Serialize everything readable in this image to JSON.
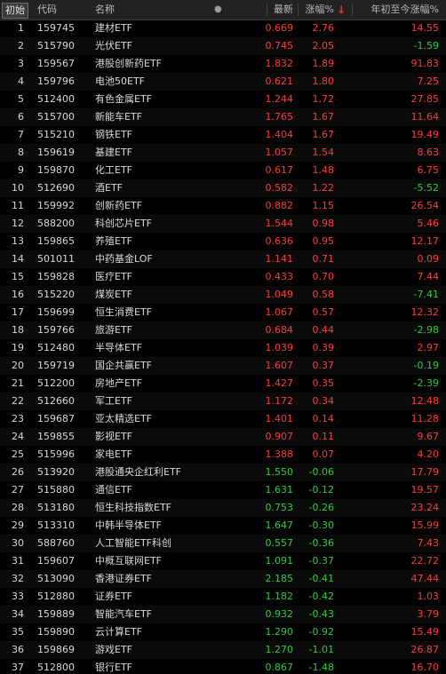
{
  "colors": {
    "up": "#ff3c3c",
    "down": "#2ecc40",
    "sort_arrow": "#e23c2f"
  },
  "header": {
    "init_button": "初始",
    "code": "代码",
    "name": "名称",
    "dot": "●",
    "price": "最新",
    "change_pct": "涨幅%",
    "sort_icon": "↓",
    "ytd_pct": "年初至今涨幅%"
  },
  "rows": [
    {
      "idx": "1",
      "code": "159745",
      "name": "建材ETF",
      "price": "0.669",
      "chg": "2.76",
      "ytd": "14.55",
      "price_dir": "up",
      "chg_dir": "up",
      "ytd_dir": "up"
    },
    {
      "idx": "2",
      "code": "515790",
      "name": "光伏ETF",
      "price": "0.745",
      "chg": "2.05",
      "ytd": "-1.59",
      "price_dir": "up",
      "chg_dir": "up",
      "ytd_dir": "down"
    },
    {
      "idx": "3",
      "code": "159567",
      "name": "港股创新药ETF",
      "price": "1.832",
      "chg": "1.89",
      "ytd": "91.83",
      "price_dir": "up",
      "chg_dir": "up",
      "ytd_dir": "up"
    },
    {
      "idx": "4",
      "code": "159796",
      "name": "电池50ETF",
      "price": "0.621",
      "chg": "1.80",
      "ytd": "7.25",
      "price_dir": "up",
      "chg_dir": "up",
      "ytd_dir": "up"
    },
    {
      "idx": "5",
      "code": "512400",
      "name": "有色金属ETF",
      "price": "1.244",
      "chg": "1.72",
      "ytd": "27.85",
      "price_dir": "up",
      "chg_dir": "up",
      "ytd_dir": "up"
    },
    {
      "idx": "6",
      "code": "515700",
      "name": "新能车ETF",
      "price": "1.765",
      "chg": "1.67",
      "ytd": "11.64",
      "price_dir": "up",
      "chg_dir": "up",
      "ytd_dir": "up"
    },
    {
      "idx": "7",
      "code": "515210",
      "name": "钢铁ETF",
      "price": "1.404",
      "chg": "1.67",
      "ytd": "19.49",
      "price_dir": "up",
      "chg_dir": "up",
      "ytd_dir": "up"
    },
    {
      "idx": "8",
      "code": "159619",
      "name": "基建ETF",
      "price": "1.057",
      "chg": "1.54",
      "ytd": "8.63",
      "price_dir": "up",
      "chg_dir": "up",
      "ytd_dir": "up"
    },
    {
      "idx": "9",
      "code": "159870",
      "name": "化工ETF",
      "price": "0.617",
      "chg": "1.48",
      "ytd": "6.75",
      "price_dir": "up",
      "chg_dir": "up",
      "ytd_dir": "up"
    },
    {
      "idx": "10",
      "code": "512690",
      "name": "酒ETF",
      "price": "0.582",
      "chg": "1.22",
      "ytd": "-5.52",
      "price_dir": "up",
      "chg_dir": "up",
      "ytd_dir": "down"
    },
    {
      "idx": "11",
      "code": "159992",
      "name": "创新药ETF",
      "price": "0.882",
      "chg": "1.15",
      "ytd": "26.54",
      "price_dir": "up",
      "chg_dir": "up",
      "ytd_dir": "up"
    },
    {
      "idx": "12",
      "code": "588200",
      "name": "科创芯片ETF",
      "price": "1.544",
      "chg": "0.98",
      "ytd": "5.46",
      "price_dir": "up",
      "chg_dir": "up",
      "ytd_dir": "up"
    },
    {
      "idx": "13",
      "code": "159865",
      "name": "养殖ETF",
      "price": "0.636",
      "chg": "0.95",
      "ytd": "12.17",
      "price_dir": "up",
      "chg_dir": "up",
      "ytd_dir": "up"
    },
    {
      "idx": "14",
      "code": "501011",
      "name": "中药基金LOF",
      "price": "1.141",
      "chg": "0.71",
      "ytd": "0.09",
      "price_dir": "up",
      "chg_dir": "up",
      "ytd_dir": "up"
    },
    {
      "idx": "15",
      "code": "159828",
      "name": "医疗ETF",
      "price": "0.433",
      "chg": "0.70",
      "ytd": "7.44",
      "price_dir": "up",
      "chg_dir": "up",
      "ytd_dir": "up"
    },
    {
      "idx": "16",
      "code": "515220",
      "name": "煤炭ETF",
      "price": "1.049",
      "chg": "0.58",
      "ytd": "-7.41",
      "price_dir": "up",
      "chg_dir": "up",
      "ytd_dir": "down"
    },
    {
      "idx": "17",
      "code": "159699",
      "name": "恒生消费ETF",
      "price": "1.067",
      "chg": "0.57",
      "ytd": "12.32",
      "price_dir": "up",
      "chg_dir": "up",
      "ytd_dir": "up"
    },
    {
      "idx": "18",
      "code": "159766",
      "name": "旅游ETF",
      "price": "0.684",
      "chg": "0.44",
      "ytd": "-2.98",
      "price_dir": "up",
      "chg_dir": "up",
      "ytd_dir": "down"
    },
    {
      "idx": "19",
      "code": "512480",
      "name": "半导体ETF",
      "price": "1.039",
      "chg": "0.39",
      "ytd": "2.97",
      "price_dir": "up",
      "chg_dir": "up",
      "ytd_dir": "up"
    },
    {
      "idx": "20",
      "code": "159719",
      "name": "国企共赢ETF",
      "price": "1.607",
      "chg": "0.37",
      "ytd": "-0.19",
      "price_dir": "up",
      "chg_dir": "up",
      "ytd_dir": "down"
    },
    {
      "idx": "21",
      "code": "512200",
      "name": "房地产ETF",
      "price": "1.427",
      "chg": "0.35",
      "ytd": "-2.39",
      "price_dir": "up",
      "chg_dir": "up",
      "ytd_dir": "down"
    },
    {
      "idx": "22",
      "code": "512660",
      "name": "军工ETF",
      "price": "1.172",
      "chg": "0.34",
      "ytd": "12.48",
      "price_dir": "up",
      "chg_dir": "up",
      "ytd_dir": "up"
    },
    {
      "idx": "23",
      "code": "159687",
      "name": "亚太精选ETF",
      "price": "1.401",
      "chg": "0.14",
      "ytd": "11.28",
      "price_dir": "up",
      "chg_dir": "up",
      "ytd_dir": "up"
    },
    {
      "idx": "24",
      "code": "159855",
      "name": "影视ETF",
      "price": "0.907",
      "chg": "0.11",
      "ytd": "9.67",
      "price_dir": "up",
      "chg_dir": "up",
      "ytd_dir": "up"
    },
    {
      "idx": "25",
      "code": "515996",
      "name": "家电ETF",
      "price": "1.388",
      "chg": "0.07",
      "ytd": "4.20",
      "price_dir": "up",
      "chg_dir": "up",
      "ytd_dir": "up"
    },
    {
      "idx": "26",
      "code": "513920",
      "name": "港股通央企红利ETF",
      "price": "1.550",
      "chg": "-0.06",
      "ytd": "17.79",
      "price_dir": "down",
      "chg_dir": "down",
      "ytd_dir": "up"
    },
    {
      "idx": "27",
      "code": "515880",
      "name": "通信ETF",
      "price": "1.631",
      "chg": "-0.12",
      "ytd": "19.57",
      "price_dir": "down",
      "chg_dir": "down",
      "ytd_dir": "up"
    },
    {
      "idx": "28",
      "code": "513180",
      "name": "恒生科技指数ETF",
      "price": "0.753",
      "chg": "-0.26",
      "ytd": "23.24",
      "price_dir": "down",
      "chg_dir": "down",
      "ytd_dir": "up"
    },
    {
      "idx": "29",
      "code": "513310",
      "name": "中韩半导体ETF",
      "price": "1.647",
      "chg": "-0.30",
      "ytd": "15.99",
      "price_dir": "down",
      "chg_dir": "down",
      "ytd_dir": "up"
    },
    {
      "idx": "30",
      "code": "588760",
      "name": "人工智能ETF科创",
      "price": "0.557",
      "chg": "-0.36",
      "ytd": "7.43",
      "price_dir": "down",
      "chg_dir": "down",
      "ytd_dir": "up"
    },
    {
      "idx": "31",
      "code": "159607",
      "name": "中概互联网ETF",
      "price": "1.091",
      "chg": "-0.37",
      "ytd": "22.72",
      "price_dir": "down",
      "chg_dir": "down",
      "ytd_dir": "up"
    },
    {
      "idx": "32",
      "code": "513090",
      "name": "香港证券ETF",
      "price": "2.185",
      "chg": "-0.41",
      "ytd": "47.44",
      "price_dir": "down",
      "chg_dir": "down",
      "ytd_dir": "up"
    },
    {
      "idx": "33",
      "code": "512880",
      "name": "证券ETF",
      "price": "1.182",
      "chg": "-0.42",
      "ytd": "1.03",
      "price_dir": "down",
      "chg_dir": "down",
      "ytd_dir": "up"
    },
    {
      "idx": "34",
      "code": "159889",
      "name": "智能汽车ETF",
      "price": "0.932",
      "chg": "-0.43",
      "ytd": "3.79",
      "price_dir": "down",
      "chg_dir": "down",
      "ytd_dir": "up"
    },
    {
      "idx": "35",
      "code": "159890",
      "name": "云计算ETF",
      "price": "1.290",
      "chg": "-0.92",
      "ytd": "15.49",
      "price_dir": "down",
      "chg_dir": "down",
      "ytd_dir": "up"
    },
    {
      "idx": "36",
      "code": "159869",
      "name": "游戏ETF",
      "price": "1.270",
      "chg": "-1.01",
      "ytd": "26.87",
      "price_dir": "down",
      "chg_dir": "down",
      "ytd_dir": "up"
    },
    {
      "idx": "37",
      "code": "512800",
      "name": "银行ETF",
      "price": "0.867",
      "chg": "-1.48",
      "ytd": "16.70",
      "price_dir": "down",
      "chg_dir": "down",
      "ytd_dir": "up"
    }
  ]
}
